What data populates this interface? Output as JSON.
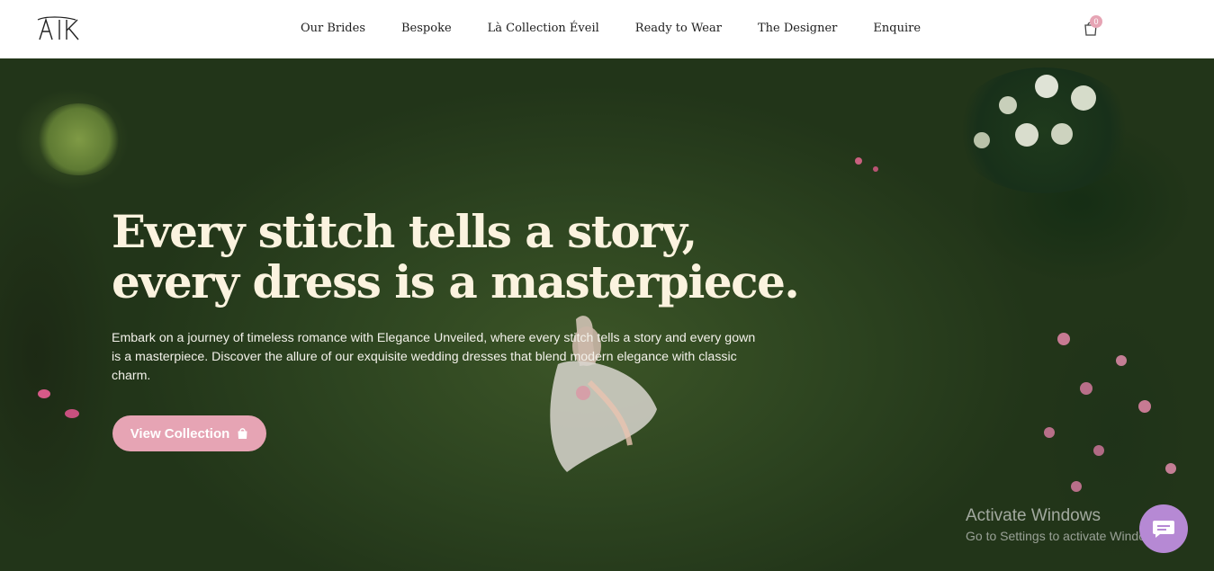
{
  "brand": {
    "logo_text": "ATK"
  },
  "nav": {
    "items": [
      {
        "label": "Our Brides"
      },
      {
        "label": "Bespoke"
      },
      {
        "label": "Là Collection Éveil"
      },
      {
        "label": "Ready to Wear"
      },
      {
        "label": "The Designer"
      },
      {
        "label": "Enquire"
      }
    ]
  },
  "cart": {
    "count": "0",
    "icon": "shopping-bag-icon"
  },
  "hero": {
    "headline_line1": "Every stitch tells a story,",
    "headline_line2": "every dress is a masterpiece.",
    "description": "Embark on a journey of timeless romance with Elegance Unveiled, where every stitch tells a story and every gown is a masterpiece. Discover the allure of our exquisite wedding dresses that blend modern elegance with classic charm.",
    "cta_label": "View Collection",
    "cta_icon": "shopping-bag-icon"
  },
  "windows_watermark": {
    "title": "Activate Windows",
    "subtitle": "Go to Settings to activate Windows."
  },
  "chat": {
    "icon": "chat-bubble-icon"
  },
  "colors": {
    "accent_pink": "#e6a4b4",
    "headline": "#fbf3df",
    "chat_purple": "#b689d4",
    "grass": "#2d4420"
  }
}
